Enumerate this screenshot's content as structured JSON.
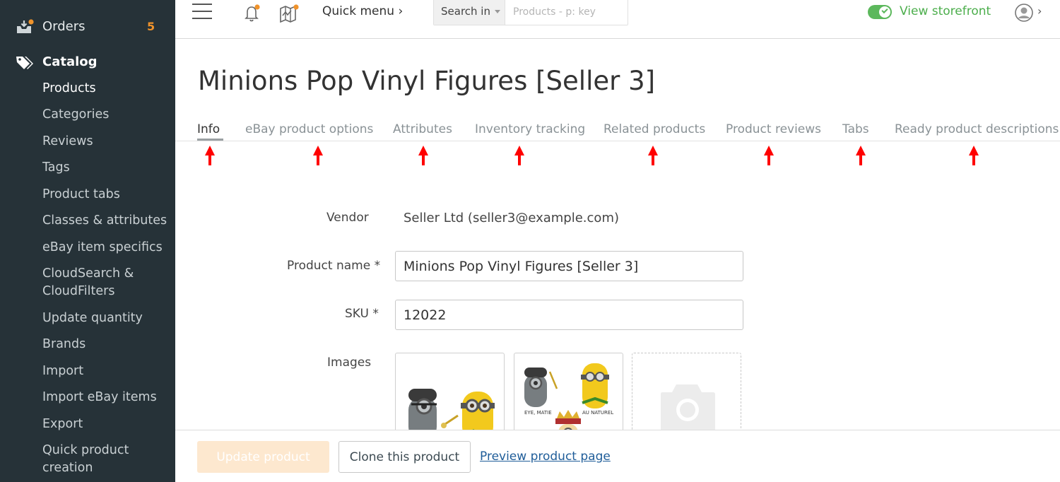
{
  "sidebar": {
    "orders_label": "Orders",
    "orders_count": "5",
    "catalog_label": "Catalog",
    "items": [
      {
        "label": "Products"
      },
      {
        "label": "Categories"
      },
      {
        "label": "Reviews"
      },
      {
        "label": "Tags"
      },
      {
        "label": "Product tabs"
      },
      {
        "label": "Classes & attributes"
      },
      {
        "label": "eBay item specifics"
      },
      {
        "label": "CloudSearch & CloudFilters"
      },
      {
        "label": "Update quantity"
      },
      {
        "label": "Brands"
      },
      {
        "label": "Import"
      },
      {
        "label": "Import eBay items"
      },
      {
        "label": "Export"
      },
      {
        "label": "Quick product creation"
      }
    ]
  },
  "topbar": {
    "quick_menu": "Quick menu ›",
    "search_in": "Search in",
    "search_placeholder": "Products - p: key",
    "storefront": "View storefront",
    "avatar_chevron": "›"
  },
  "page": {
    "title": "Minions Pop Vinyl Figures [Seller 3]"
  },
  "tabs": [
    {
      "label": "Info",
      "active": true
    },
    {
      "label": "eBay product options"
    },
    {
      "label": "Attributes"
    },
    {
      "label": "Inventory tracking"
    },
    {
      "label": "Related products"
    },
    {
      "label": "Product reviews"
    },
    {
      "label": "Tabs"
    },
    {
      "label": "Ready product descriptions"
    }
  ],
  "form": {
    "vendor_label": "Vendor",
    "vendor_value": "Seller Ltd (seller3@example.com)",
    "product_name_label": "Product name *",
    "product_name_value": "Minions Pop Vinyl Figures [Seller 3]",
    "sku_label": "SKU *",
    "sku_value": "12022",
    "images_label": "Images",
    "image2_caption_left": "EYE, MATIE",
    "image2_caption_right": "AU NATUREL"
  },
  "footer": {
    "update_button": "Update product",
    "clone_button": "Clone this product",
    "preview_link": "Preview product page"
  },
  "colors": {
    "sidebar_bg": "#263238",
    "accent_orange": "#f0932b",
    "storefront_green": "#4cae4c",
    "annotation_arrow": "#ff0000"
  }
}
